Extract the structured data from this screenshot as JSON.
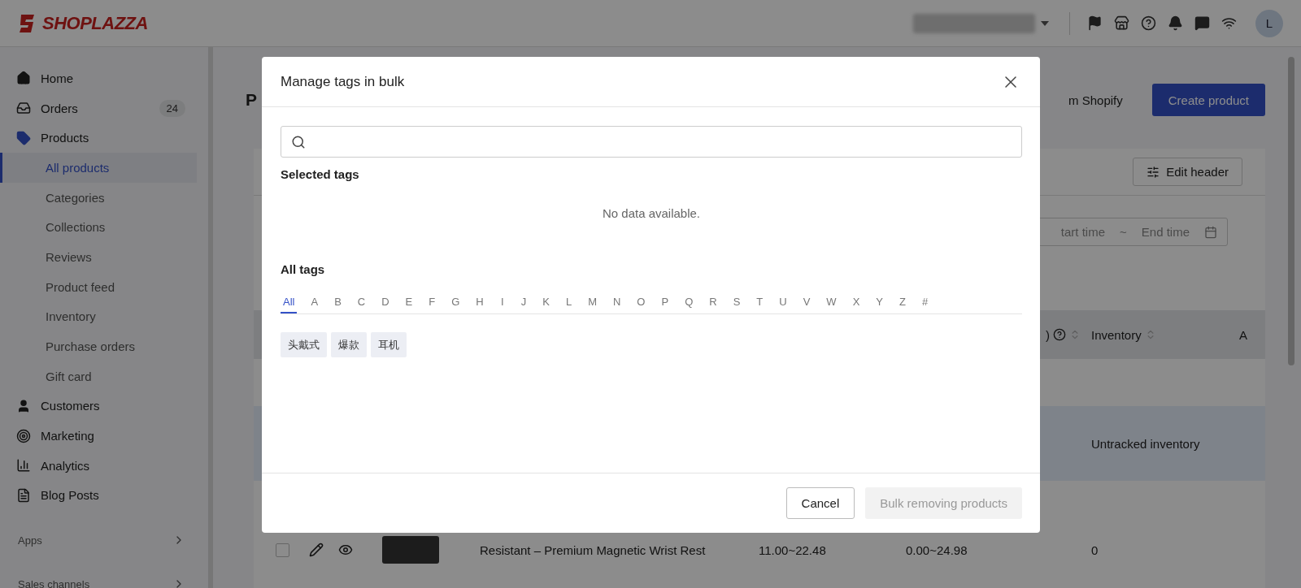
{
  "topbar": {
    "logo": "SHOPLAZZA",
    "avatar": "L"
  },
  "sidebar": {
    "items": [
      {
        "label": "Home"
      },
      {
        "label": "Orders",
        "badge": "24"
      },
      {
        "label": "Products",
        "children": [
          {
            "label": "All products",
            "selected": true
          },
          {
            "label": "Categories",
            "selected": false
          },
          {
            "label": "Collections",
            "selected": false
          },
          {
            "label": "Reviews",
            "selected": false
          },
          {
            "label": "Product feed",
            "selected": false
          },
          {
            "label": "Inventory",
            "selected": false
          },
          {
            "label": "Purchase orders",
            "selected": false
          },
          {
            "label": "Gift card",
            "selected": false
          }
        ]
      },
      {
        "label": "Customers"
      },
      {
        "label": "Marketing"
      },
      {
        "label": "Analytics"
      },
      {
        "label": "Blog Posts"
      }
    ],
    "sections": [
      "Apps",
      "Sales channels"
    ]
  },
  "page": {
    "title": "P",
    "import_link": "m Shopify",
    "create_button": "Create product",
    "edit_header": "Edit header",
    "date_range": {
      "start": "tart time",
      "separator": "~",
      "end": "End time"
    },
    "table": {
      "columns": [
        {
          "label": ")",
          "help": true,
          "sortable": true
        },
        {
          "label": "Inventory",
          "help": false,
          "sortable": true
        },
        {
          "label": "A",
          "help": false,
          "sortable": false
        }
      ],
      "rows": [
        {
          "highlighted": true,
          "inventory": "Untracked inventory"
        },
        {
          "highlighted": false,
          "title": "Resistant – Premium Magnetic Wrist Rest",
          "price": "11.00~22.48",
          "compare": "0.00~24.98",
          "inventory": "0"
        }
      ]
    }
  },
  "dialog": {
    "title": "Manage tags in bulk",
    "selected_label": "Selected tags",
    "empty": "No data available.",
    "all_label": "All tags",
    "letters": [
      {
        "label": "All",
        "selected": true
      },
      {
        "label": "A",
        "selected": false
      },
      {
        "label": "B",
        "selected": false
      },
      {
        "label": "C",
        "selected": false
      },
      {
        "label": "D",
        "selected": false
      },
      {
        "label": "E",
        "selected": false
      },
      {
        "label": "F",
        "selected": false
      },
      {
        "label": "G",
        "selected": false
      },
      {
        "label": "H",
        "selected": false
      },
      {
        "label": "I",
        "selected": false
      },
      {
        "label": "J",
        "selected": false
      },
      {
        "label": "K",
        "selected": false
      },
      {
        "label": "L",
        "selected": false
      },
      {
        "label": "M",
        "selected": false
      },
      {
        "label": "N",
        "selected": false
      },
      {
        "label": "O",
        "selected": false
      },
      {
        "label": "P",
        "selected": false
      },
      {
        "label": "Q",
        "selected": false
      },
      {
        "label": "R",
        "selected": false
      },
      {
        "label": "S",
        "selected": false
      },
      {
        "label": "T",
        "selected": false
      },
      {
        "label": "U",
        "selected": false
      },
      {
        "label": "V",
        "selected": false
      },
      {
        "label": "W",
        "selected": false
      },
      {
        "label": "X",
        "selected": false
      },
      {
        "label": "Y",
        "selected": false
      },
      {
        "label": "Z",
        "selected": false
      },
      {
        "label": "#",
        "selected": false
      }
    ],
    "tags": [
      "头戴式",
      "爆款",
      "耳机"
    ],
    "cancel": "Cancel",
    "confirm": {
      "label": "Bulk removing products",
      "disabled": true
    }
  }
}
